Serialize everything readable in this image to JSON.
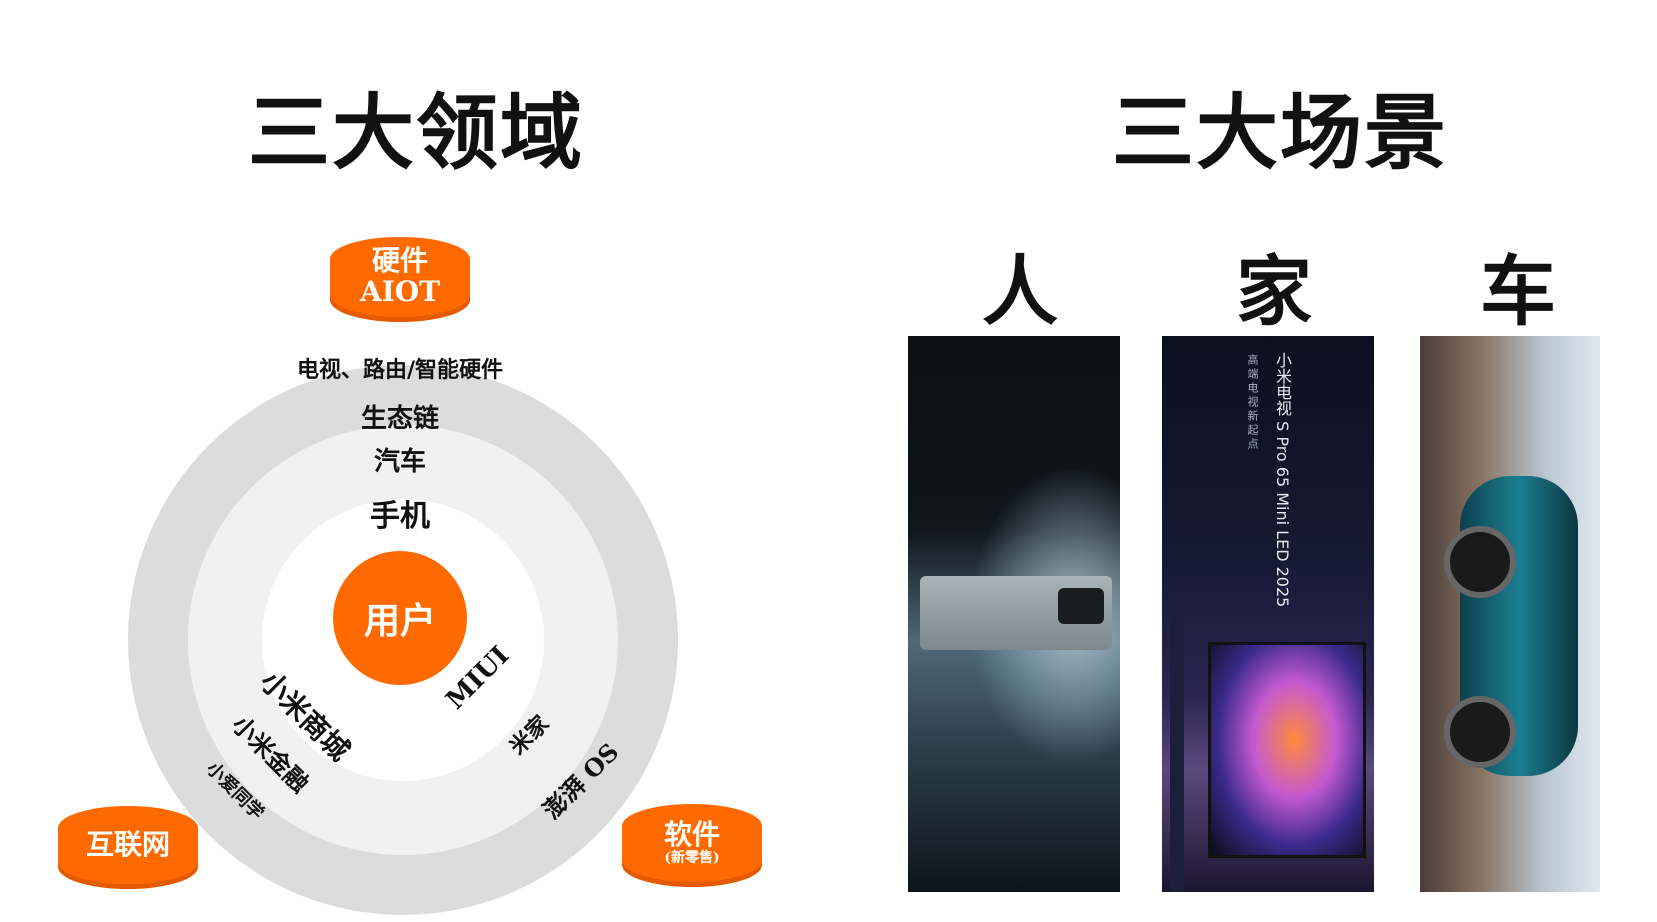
{
  "left_section": {
    "title": "三大领域",
    "core": "用户",
    "rings": {
      "outer_top": "电视、路由/智能硬件",
      "mid_top_1": "生态链",
      "mid_top_2": "汽车",
      "inner_top": "手机"
    },
    "channels_left": [
      "小米商城",
      "小米金融",
      "小爱同学"
    ],
    "channels_right": [
      "MIUI",
      "米家",
      "澎湃 OS"
    ],
    "pills": {
      "hardware": {
        "line1": "硬件",
        "line2": "AIOT"
      },
      "internet": {
        "label": "互联网"
      },
      "software": {
        "label": "软件",
        "sub": "(新零售)"
      }
    }
  },
  "right_section": {
    "title": "三大场景",
    "scenes": [
      {
        "label": "人",
        "image": "phone-photo"
      },
      {
        "label": "家",
        "image": "tv-photo",
        "product_text": "小米电视 S Pro 65 Mini LED 2025",
        "tagline": "高端电视新起点"
      },
      {
        "label": "车",
        "image": "car-photo"
      }
    ]
  },
  "colors": {
    "accent": "#ff6a00",
    "ring_outer": "#dcdcdc",
    "ring_mid": "#f1f1f1",
    "text": "#111111"
  }
}
